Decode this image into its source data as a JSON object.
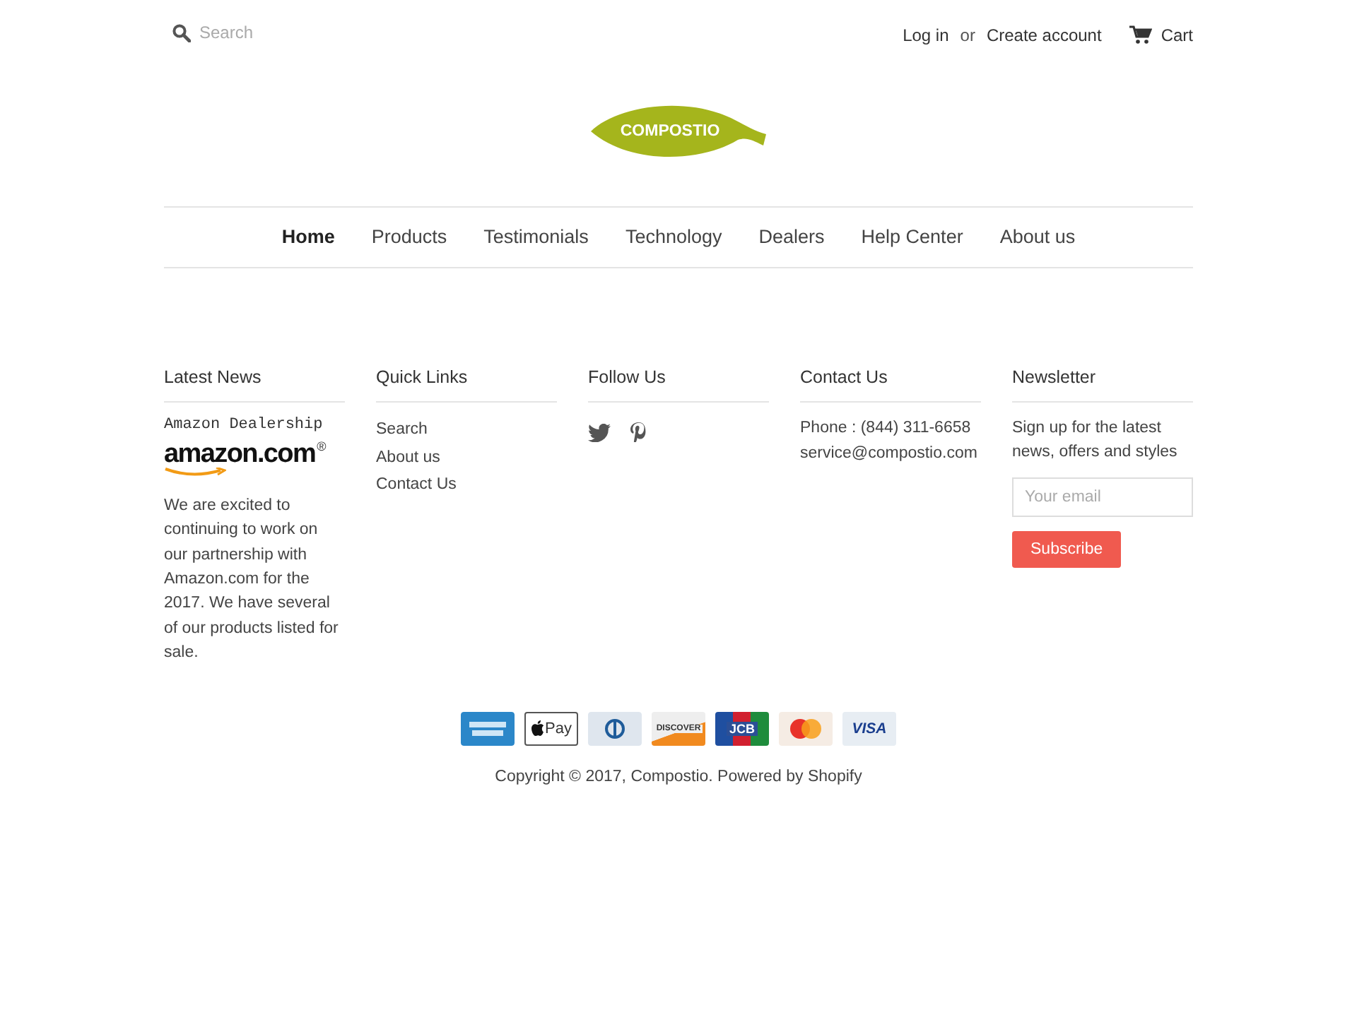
{
  "header": {
    "search": {
      "placeholder": "Search"
    },
    "links": [
      {
        "kind": "link",
        "text": "Log in"
      },
      {
        "kind": "plain",
        "text": "or"
      },
      {
        "kind": "link",
        "text": "Create account"
      }
    ],
    "cart": "Cart"
  },
  "logo": {
    "text": "COMPOSTIO"
  },
  "nav": [
    {
      "label": "Home",
      "selected": true
    },
    {
      "label": "Products",
      "selected": false
    },
    {
      "label": "Testimonials",
      "selected": false
    },
    {
      "label": "Technology",
      "selected": false
    },
    {
      "label": "Dealers",
      "selected": false
    },
    {
      "label": "Help Center",
      "selected": false
    },
    {
      "label": "About us",
      "selected": false
    }
  ],
  "footer": {
    "columns": [
      {
        "kind": "news",
        "title": "Latest News",
        "post_title": "Amazon Dealership",
        "brand": "amazon.com",
        "brand_mark": "®",
        "body": "We are excited to continuing to work on our partnership with Amazon.com for the 2017. We have several of our products listed for sale."
      },
      {
        "kind": "links",
        "title": "Quick Links",
        "links": [
          "Search",
          "About us",
          "Contact Us"
        ]
      },
      {
        "kind": "social",
        "title": "Follow Us",
        "icons": [
          {
            "kind": "twitter"
          },
          {
            "kind": "pinterest"
          }
        ]
      },
      {
        "kind": "contact",
        "title": "Contact Us",
        "lines": [
          "Phone : (844) 311-6658",
          "service@compostio.com"
        ]
      },
      {
        "kind": "newsletter",
        "title": "Newsletter",
        "text": "Sign up for the latest news, offers and styles",
        "placeholder": "Your email",
        "button": "Subscribe"
      }
    ]
  },
  "payment_icons": [
    {
      "kind": "amex"
    },
    {
      "kind": "applepay",
      "text": "Pay"
    },
    {
      "kind": "diners"
    },
    {
      "kind": "discover",
      "text": "DISCOVER"
    },
    {
      "kind": "jcb",
      "text": "JCB"
    },
    {
      "kind": "mastercard"
    },
    {
      "kind": "visa",
      "text": "VISA"
    }
  ],
  "copyright": "Copyright © 2017, Compostio. Powered by Shopify"
}
